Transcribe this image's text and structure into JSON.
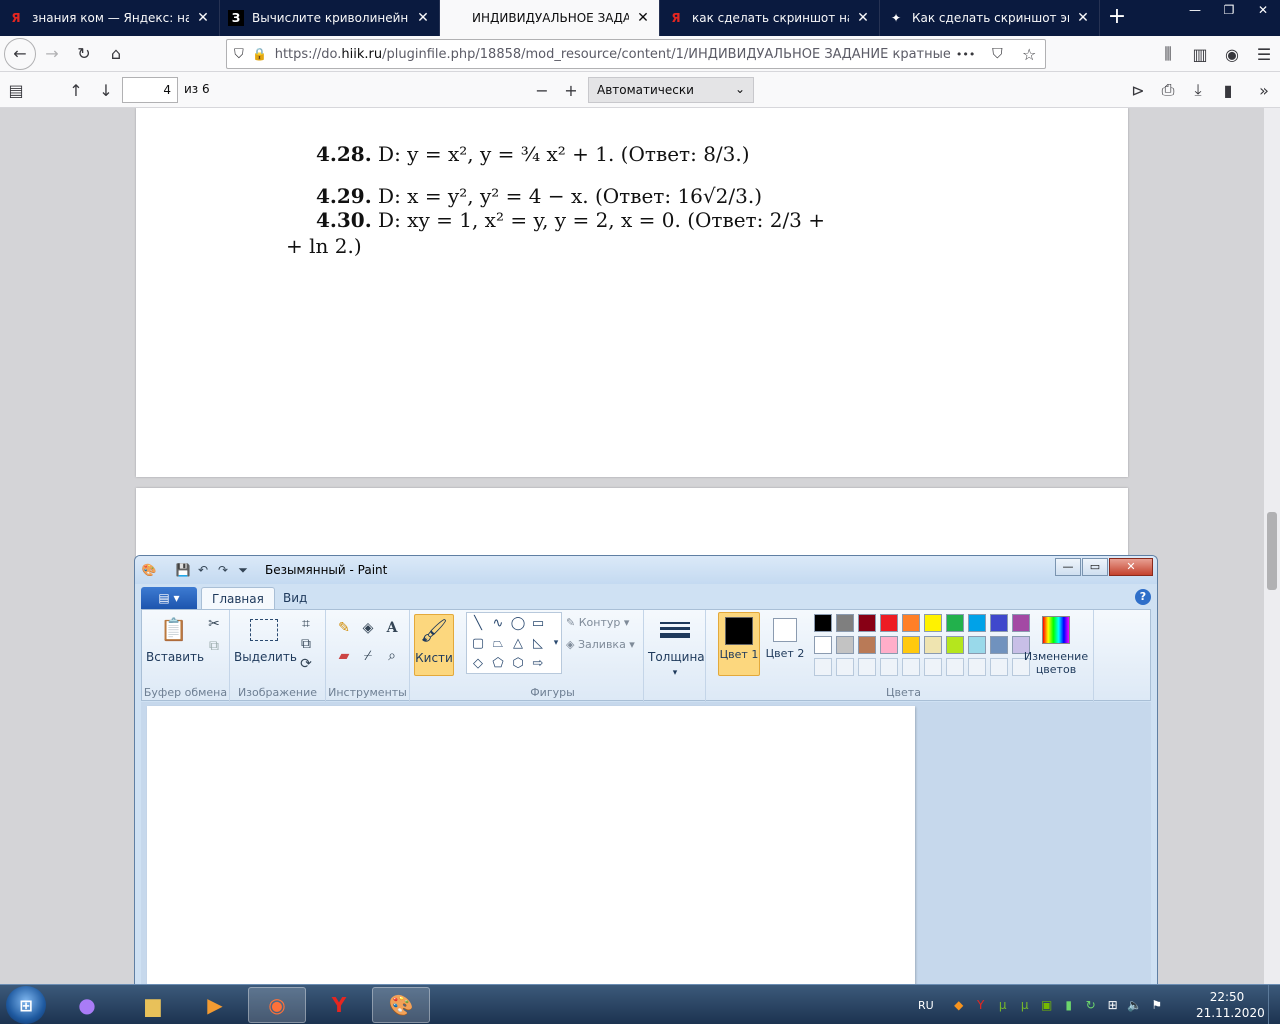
{
  "browser": {
    "tabs": [
      {
        "favicon": "yandex-icon",
        "icon_glyph": "Я",
        "icon_color": "#e52620",
        "title": "знания ком — Яндекс: нашлось",
        "active": false
      },
      {
        "favicon": "znanija-icon",
        "icon_glyph": "З",
        "icon_color": "#ffffff",
        "title": "Вычислите криволинейный интеграл",
        "active": false
      },
      {
        "favicon": "pdf-icon",
        "icon_glyph": "",
        "icon_color": "#0c0c0d",
        "title": "ИНДИВИДУАЛЬНОЕ ЗАДАНИЕ кратные",
        "active": true
      },
      {
        "favicon": "yandex-icon",
        "icon_glyph": "Я",
        "icon_color": "#e52620",
        "title": "как сделать скриншот на компьютере",
        "active": false
      },
      {
        "favicon": "star-icon",
        "icon_glyph": "✦",
        "icon_color": "#ffffff",
        "title": "Как сделать скриншот экрана",
        "active": false
      }
    ],
    "url_prefix": "https://do.",
    "url_domain": "hiik.ru",
    "url_rest": "/pluginfile.php/18858/mod_resource/content/1/ИНДИВИДУАЛЬНОЕ ЗАДАНИЕ кратные и к",
    "url_more": "•••"
  },
  "pdf": {
    "page_number": "4",
    "page_count": "из 6",
    "zoom": "Автоматически",
    "problems": [
      {
        "num": "4.28.",
        "text": "D:  y = x², y = ¾ x² + 1.  (Ответ:  8/3.)"
      },
      {
        "num": "4.29.",
        "text": "D:  x = y², y² = 4 − x.  (Ответ:  16√2/3.)"
      },
      {
        "num": "4.30.",
        "text": "D:  xy = 1,  x² = y,  y = 2,  x = 0.  (Ответ:  2/3 +"
      },
      {
        "num": "",
        "text": "+ ln 2.)"
      }
    ]
  },
  "paint": {
    "title": "Безымянный - Paint",
    "tabs": [
      "Главная",
      "Вид"
    ],
    "groups": {
      "clipboard": "Буфер обмена",
      "image": "Изображение",
      "tools": "Инструменты",
      "shapes": "Фигуры",
      "colors": "Цвета"
    },
    "buttons": {
      "paste": "Вставить",
      "select": "Выделить",
      "brushes": "Кисти",
      "outline": "Контур",
      "fill": "Заливка",
      "thickness": "Толщина",
      "color1": "Цвет 1",
      "color2": "Цвет 2",
      "edit_colors": "Изменение цветов"
    },
    "palette_row1": [
      "#000000",
      "#7f7f7f",
      "#880015",
      "#ed1c24",
      "#ff7f27",
      "#fff200",
      "#22b14c",
      "#00a2e8",
      "#3f48cc",
      "#a349a4"
    ],
    "palette_row2": [
      "#ffffff",
      "#c3c3c3",
      "#b97a57",
      "#ffaec9",
      "#ffc90e",
      "#efe4b0",
      "#b5e61d",
      "#99d9ea",
      "#7092be",
      "#c8bfe7"
    ]
  },
  "taskbar": {
    "lang": "RU",
    "time": "22:50",
    "date": "21.11.2020"
  }
}
